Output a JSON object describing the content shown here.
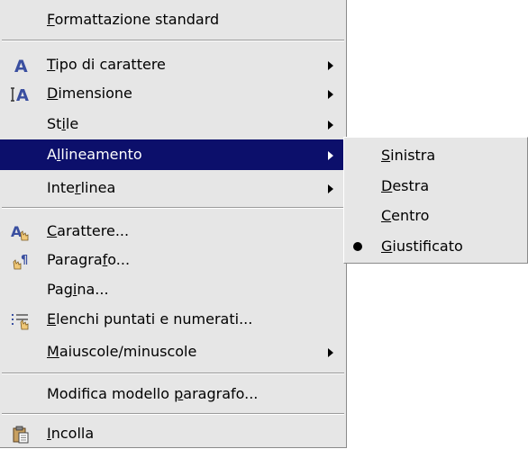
{
  "main_menu": {
    "items": [
      {
        "pre": "",
        "ul": "F",
        "post": "ormattazione standard"
      },
      {
        "pre": "",
        "ul": "T",
        "post": "ipo di carattere"
      },
      {
        "pre": "",
        "ul": "D",
        "post": "imensione"
      },
      {
        "pre": "St",
        "ul": "i",
        "post": "le"
      },
      {
        "pre": "A",
        "ul": "l",
        "post": "lineamento"
      },
      {
        "pre": "Inte",
        "ul": "r",
        "post": "linea"
      },
      {
        "pre": "",
        "ul": "C",
        "post": "arattere..."
      },
      {
        "pre": "Paragra",
        "ul": "f",
        "post": "o..."
      },
      {
        "pre": "Pag",
        "ul": "i",
        "post": "na..."
      },
      {
        "pre": "",
        "ul": "E",
        "post": "lenchi puntati e numerati..."
      },
      {
        "pre": "",
        "ul": "M",
        "post": "aiuscole/minuscole"
      },
      {
        "pre": "Modifica modello ",
        "ul": "p",
        "post": "aragrafo..."
      },
      {
        "pre": "",
        "ul": "I",
        "post": "ncolla"
      }
    ]
  },
  "sub_menu": {
    "items": [
      {
        "pre": "",
        "ul": "S",
        "post": "inistra"
      },
      {
        "pre": "",
        "ul": "D",
        "post": "estra"
      },
      {
        "pre": "",
        "ul": "C",
        "post": "entro"
      },
      {
        "pre": "",
        "ul": "G",
        "post": "iustificato"
      }
    ]
  },
  "icons": {
    "font_type": "font-icon",
    "font_size": "font-size-icon",
    "character": "character-format-icon",
    "paragraph": "paragraph-format-icon",
    "bullets": "bullets-numbering-icon",
    "paste": "paste-icon",
    "selected_bullet": "radio-bullet-icon"
  },
  "colors": {
    "menu_bg": "#e6e6e6",
    "highlight_bg": "#0c0f6b",
    "icon_blue": "#3a4fa0"
  }
}
